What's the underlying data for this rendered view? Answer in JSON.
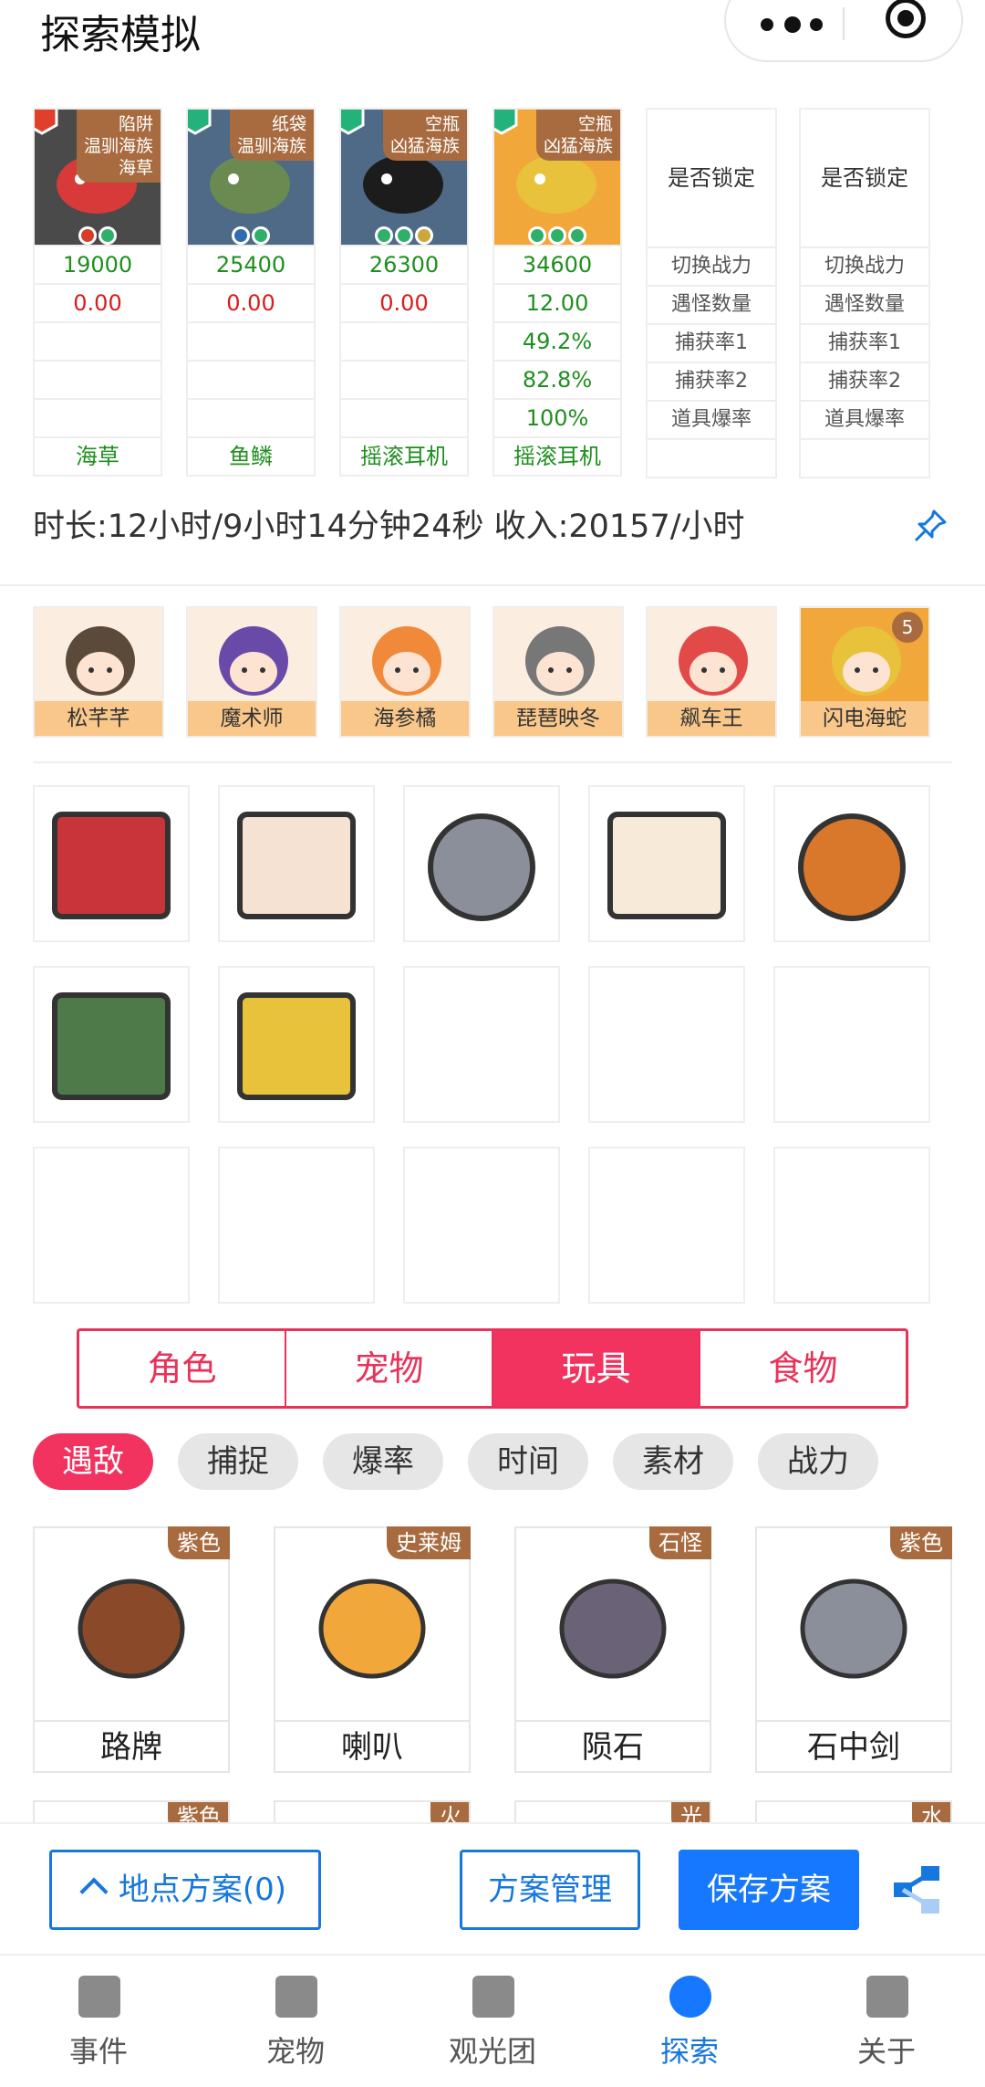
{
  "header": {
    "title": "探索模拟"
  },
  "fish": [
    {
      "tag": [
        "陷阱",
        "温驯海族",
        "海草"
      ],
      "power": "19000",
      "v2": "0.00",
      "v3": "",
      "v4": "",
      "v5": "",
      "bait": "海草",
      "bg": "#4a4a4a"
    },
    {
      "tag": [
        "纸袋",
        "温驯海族"
      ],
      "power": "25400",
      "v2": "0.00",
      "v3": "",
      "v4": "",
      "v5": "",
      "bait": "鱼鳞",
      "bg": "#4f6a86"
    },
    {
      "tag": [
        "空瓶",
        "凶猛海族"
      ],
      "power": "26300",
      "v2": "0.00",
      "v3": "",
      "v4": "",
      "v5": "",
      "bait": "摇滚耳机",
      "bg": "#4f6a86"
    },
    {
      "tag": [
        "空瓶",
        "凶猛海族"
      ],
      "power": "34600",
      "v2": "12.00",
      "v3": "49.2%",
      "v4": "82.8%",
      "v5": "100%",
      "bait": "摇滚耳机",
      "bg": "#f2a73a"
    }
  ],
  "lockcols": [
    {
      "head": "是否锁定",
      "rows": [
        "切换战力",
        "遇怪数量",
        "捕获率1",
        "捕获率2",
        "道具爆率"
      ]
    },
    {
      "head": "是否锁定",
      "rows": [
        "切换战力",
        "遇怪数量",
        "捕获率1",
        "捕获率2",
        "道具爆率"
      ]
    }
  ],
  "summary": "时长:12小时/9小时14分钟24秒 收入:20157/小时",
  "characters": [
    {
      "name": "松芊芊",
      "bg": "#fbeee0"
    },
    {
      "name": "魔术师",
      "bg": "#fbeee0"
    },
    {
      "name": "海参橘",
      "bg": "#fbeee0"
    },
    {
      "name": "琵琶映冬",
      "bg": "#fbeee0"
    },
    {
      "name": "飙车王",
      "bg": "#fbeee0"
    },
    {
      "name": "闪电海蛇",
      "bg": "#f2a73a",
      "badge": "5"
    }
  ],
  "tabs": [
    {
      "label": "角色"
    },
    {
      "label": "宠物"
    },
    {
      "label": "玩具",
      "active": true
    },
    {
      "label": "食物"
    }
  ],
  "chips": [
    {
      "label": "遇敌",
      "active": true
    },
    {
      "label": "捕捉"
    },
    {
      "label": "爆率"
    },
    {
      "label": "时间"
    },
    {
      "label": "素材"
    },
    {
      "label": "战力"
    }
  ],
  "items": [
    {
      "tag": "紫色",
      "name": "路牌"
    },
    {
      "tag": "史莱姆",
      "name": "喇叭"
    },
    {
      "tag": "石怪",
      "name": "陨石"
    },
    {
      "tag": "紫色",
      "name": "石中剑"
    }
  ],
  "items_next_tags": [
    "紫色",
    "火",
    "光",
    "水"
  ],
  "actions": {
    "location_plan": "地点方案(0)",
    "manage": "方案管理",
    "save": "保存方案"
  },
  "nav": [
    {
      "label": "事件"
    },
    {
      "label": "宠物"
    },
    {
      "label": "观光团"
    },
    {
      "label": "探索",
      "active": true
    },
    {
      "label": "关于"
    }
  ],
  "colors": {
    "accent": "#f2335f",
    "primary": "#1677ff",
    "tag": "#a86b3f",
    "green": "#1f8f1f",
    "red": "#d91c1c"
  }
}
